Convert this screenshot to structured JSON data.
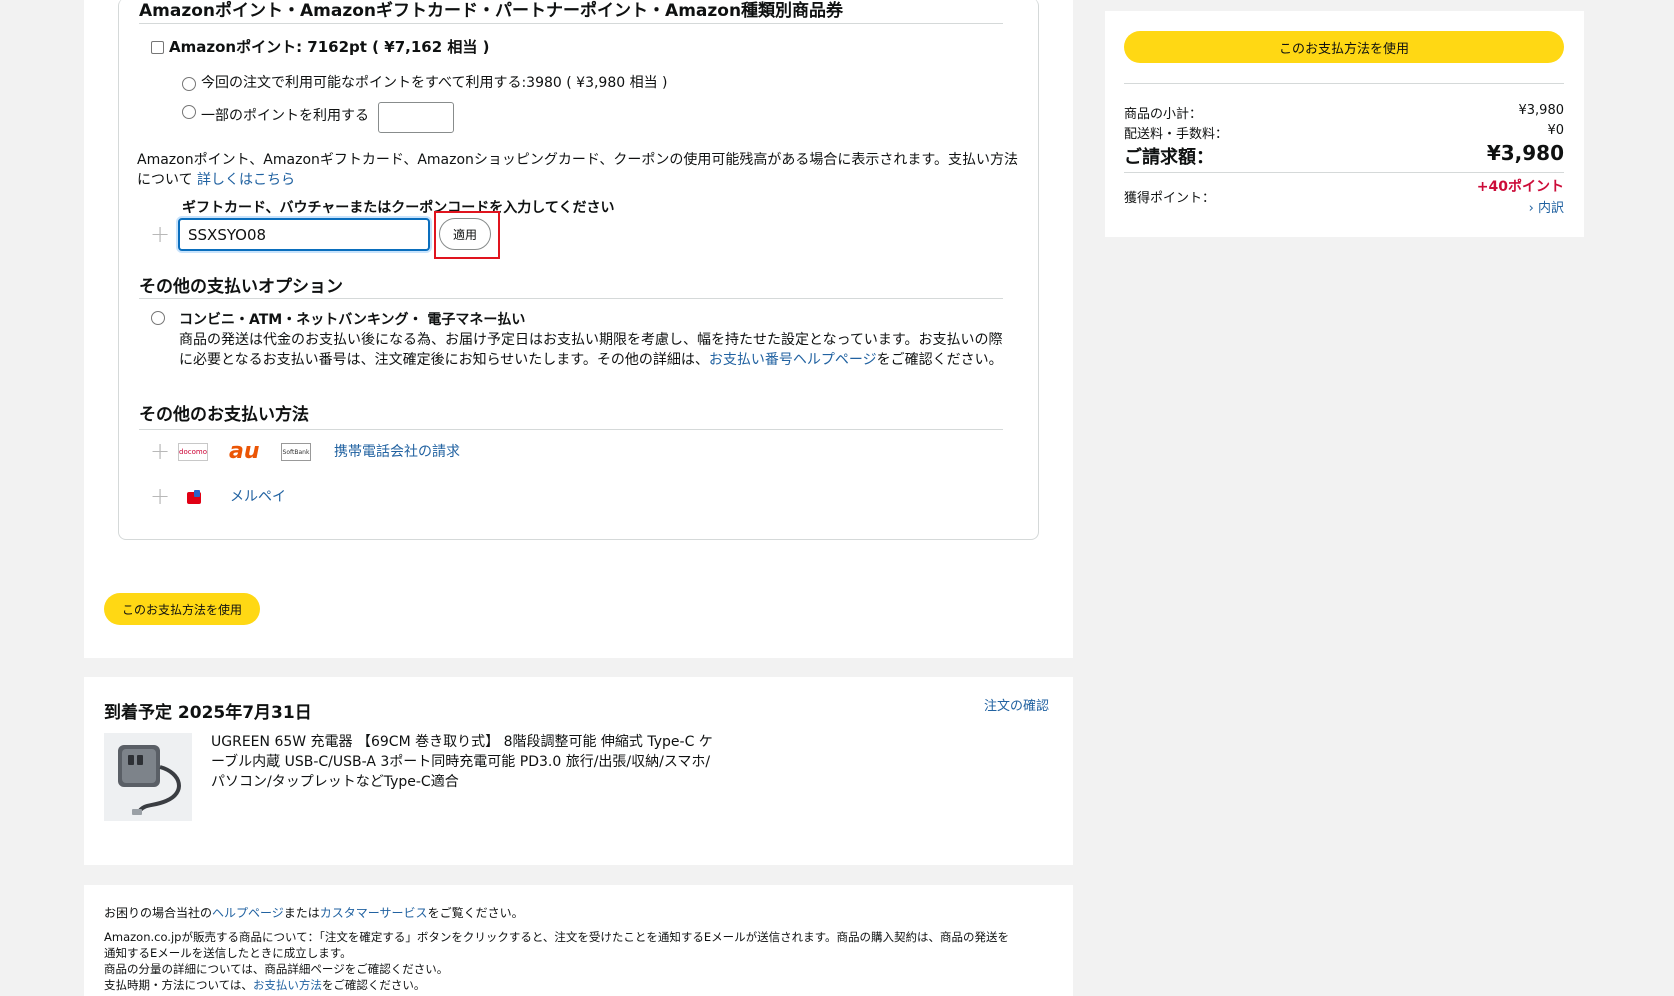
{
  "payment": {
    "gift_section_title": "Amazonポイント・Amazonギフトカード・パートナーポイント・Amazon種類別商品券",
    "points_checkbox_label": "Amazonポイント: 7162pt ( ¥7,162 相当 )",
    "use_all_points_label": "今回の注文で利用可能なポイントをすべて利用する:3980 ( ¥3,980 相当 )",
    "use_some_points_label": "一部のポイントを利用する",
    "info_text_line1": "Amazonポイント、Amazonギフトカード、Amazonショッピングカード、クーポンの使用可能残高がある場合に表示されます。支払い方法",
    "info_text_line2": "について",
    "learn_more_link": "詳しくはこちら",
    "code_label": "ギフトカード、バウチャーまたはクーポンコードを入力してください",
    "code_value": "SSXSYO08",
    "apply_button": "適用",
    "other_options_title": "その他の支払いオプション",
    "convenience_title": "コンビニ・ATM・ネットバンキング・ 電子マネー払い",
    "convenience_desc_line1": "商品の発送は代金のお支払い後になる為、お届け予定日はお支払い期限を考慮し、幅を持たせた設定となっています。お支払いの際",
    "convenience_desc_line2_pre": "に必要となるお支払い番号は、注文確定後にお知らせいたします。その他の詳細は、",
    "convenience_help_link": "お支払い番号ヘルプページ",
    "convenience_desc_line2_post": "をご確認ください。",
    "other_methods_title": "その他のお支払い方法",
    "carrier_docomo_logo": "docomo",
    "carrier_au_logo": "au",
    "carrier_softbank_logo": "SoftBank",
    "carrier_billing_link": "携帯電話会社の請求",
    "merpay_link": "メルペイ",
    "use_method_button": "このお支払方法を使用"
  },
  "delivery": {
    "title": "到着予定 2025年7月31日",
    "review_link": "注文の確認",
    "product_line1": "UGREEN 65W 充電器 【69CM 巻き取り式】 8階段調整可能 伸縮式 Type-C ケ",
    "product_line2": "ーブル内蔵 USB-C/USB-A 3ポート同時充電可能 PD3.0 旅行/出張/収納/スマホ/",
    "product_line3": "パソコン/タップレットなどType-C適合"
  },
  "footer": {
    "help_pre": "お困りの場合当社の",
    "help_link": "ヘルプページ",
    "help_mid": "または",
    "cs_link": "カスタマーサービス",
    "help_post": "をご覧ください。",
    "line1": "Amazon.co.jpが販売する商品について：「注文を確定する」ボタンをクリックすると、注文を受けたことを通知するEメールが送信されます。商品の購入契約は、商品の発送を",
    "line2": "通知するEメールを送信したときに成立します。",
    "line3": "商品の分量の詳細については、商品詳細ページをご確認ください。",
    "line4_pre": "支払時期・方法については、",
    "line4_link": "お支払い方法",
    "line4_post": "をご確認ください。"
  },
  "summary": {
    "use_method_button": "このお支払方法を使用",
    "subtotal_label": "商品の小計：",
    "subtotal_value": "¥3,980",
    "shipping_label": "配送料・手数料：",
    "shipping_value": "¥0",
    "total_label": "ご請求額：",
    "total_value": "¥3,980",
    "points_label": "獲得ポイント：",
    "points_value": "+40ポイント",
    "breakdown_link": "› 内訳"
  },
  "colors": {
    "accent_yellow": "#ffd814",
    "link_blue": "#2162a1",
    "points_red": "#cc0c39",
    "highlight_red": "#e0141e"
  }
}
